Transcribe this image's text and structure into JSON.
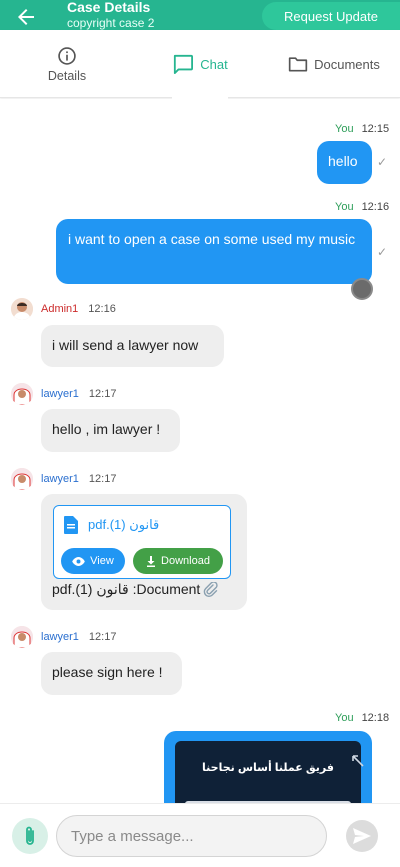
{
  "header": {
    "title": "Case Details",
    "subtitle": "copyright case 2",
    "request_update_label": "Request Update",
    "accent_color": "#26b590"
  },
  "tabs": [
    {
      "label": "Details",
      "icon": "info-icon",
      "active": false
    },
    {
      "label": "Chat",
      "icon": "chat-icon",
      "active": true
    },
    {
      "label": "Documents",
      "icon": "folder-icon",
      "active": false
    }
  ],
  "messages": [
    {
      "sender": "You",
      "time": "12:15",
      "text": "hello",
      "mine": true,
      "status": "sent-check"
    },
    {
      "sender": "You",
      "time": "12:16",
      "text": "i want to open a case on some used my music",
      "mine": true,
      "status": "sent-check"
    },
    {
      "sender": "Admin1",
      "time": "12:16",
      "text": "i will send a lawyer now",
      "mine": false
    },
    {
      "sender": "lawyer1",
      "time": "12:17",
      "text": "hello , im lawyer !",
      "mine": false
    },
    {
      "sender": "lawyer1",
      "time": "12:17",
      "mine": false,
      "document": {
        "file_name": "قانون (1).pdf",
        "view_label": "View",
        "download_label": "Download",
        "caption": "pdf.(1) قانون :Document"
      }
    },
    {
      "sender": "lawyer1",
      "time": "12:17",
      "text": "please sign here !",
      "mine": false
    },
    {
      "sender": "You",
      "time": "12:18",
      "mine": true,
      "image": {
        "overlay_text": "فريق عملنا أساس نجاحنا"
      }
    }
  ],
  "composer": {
    "placeholder": "Type a message...",
    "value": ""
  },
  "colors": {
    "my_bubble": "#2196f3",
    "their_bubble": "#eeeeee",
    "view_button": "#2196f3",
    "download_button": "#43a047",
    "admin_name": "#cc2b2b",
    "lawyer_name": "#2a6fcf",
    "you_label": "#2e9e5a"
  }
}
